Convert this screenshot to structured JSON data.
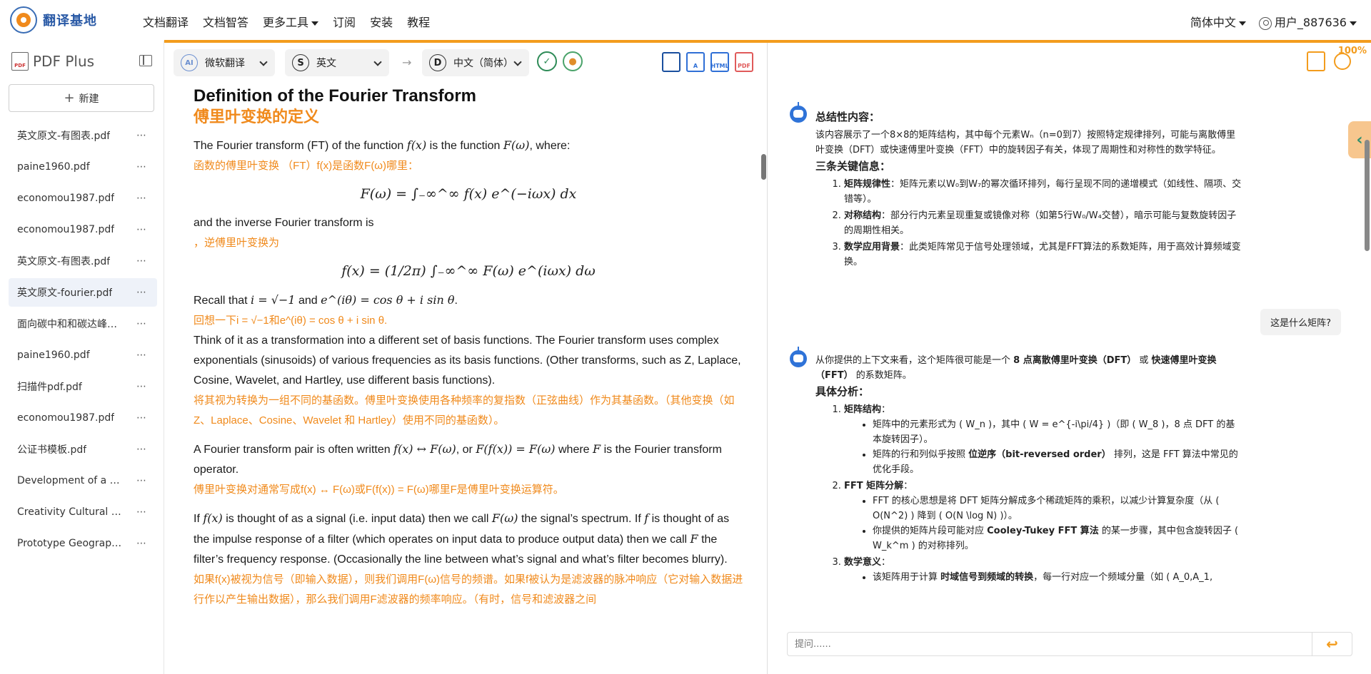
{
  "brand": {
    "name": "翻译基地"
  },
  "nav": {
    "items": [
      "文档翻译",
      "文档智答",
      "更多工具",
      "订阅",
      "安装",
      "教程"
    ],
    "language": "简体中文",
    "user": "用户_887636"
  },
  "sidebar": {
    "title": "PDF Plus",
    "new_label": "新建",
    "files": [
      "英文原文-有图表.pdf",
      "paine1960.pdf",
      "economou1987.pdf",
      "economou1987.pdf",
      "英文原文-有图表.pdf",
      "英文原文-fourier.pdf",
      "面向碳中和和碳达峰…",
      "paine1960.pdf",
      "扫描件pdf.pdf",
      "economou1987.pdf",
      "公证书模板.pdf",
      "Development of a W…",
      "Creativity Cultural Ca…",
      "Prototype Geographi…"
    ],
    "active_index": 5,
    "more": "⋯"
  },
  "toolbar": {
    "engine": "微软翻译",
    "source_lang": "英文",
    "target_lang": "中文（简体）",
    "arrow": "→",
    "src_icon": "S",
    "tgt_icon": "D",
    "engine_icon": "AI",
    "html_label": "HTML",
    "pdf_label": "PDF"
  },
  "document": {
    "title_en": "Definition of the Fourier Transform",
    "title_zh": "傅里叶变换的定义",
    "p1_en_a": "The Fourier transform (FT) of the function ",
    "p1_en_m1": "f(x)",
    "p1_en_b": " is the function ",
    "p1_en_m2": "F(ω)",
    "p1_en_c": ", where:",
    "p1_zh": "函数的傅里叶变换 （FT）f(x)是函数F(ω)哪里：",
    "eq1": "F(ω) = ∫₋∞^∞ f(x) e^(−iωx) dx",
    "p2_en": "and the inverse Fourier transform is",
    "p2_zh": "，逆傅里叶变换为",
    "eq2": "f(x) = (1/2π) ∫₋∞^∞ F(ω) e^(iωx) dω",
    "p3_en_a": "Recall that ",
    "p3_en_m1": "i = √−1",
    "p3_en_b": " and ",
    "p3_en_m2": "e^(iθ) = cos θ + i sin θ",
    "p3_en_c": ".",
    "p3_zh": "回想一下i = √−1和e^(iθ) = cos θ + i sin θ.",
    "p4_en": "Think of it as a transformation into a different set of basis functions. The Fourier transform uses complex exponentials (sinusoids) of various frequencies as its basis functions. (Other transforms, such as Z, Laplace, Cosine, Wavelet, and Hartley, use different basis functions).",
    "p4_zh": "将其视为转换为一组不同的基函数。傅里叶变换使用各种频率的复指数（正弦曲线）作为其基函数。（其他变换（如 Z、Laplace、Cosine、Wavelet 和 Hartley）使用不同的基函数）。",
    "p5_en_a": "A Fourier transform pair is often written ",
    "p5_en_m1": "f(x) ↔ F(ω)",
    "p5_en_b": ", or ",
    "p5_en_m2": "F(f(x)) = F(ω)",
    "p5_en_c": " where ",
    "p5_en_m3": "F",
    "p5_en_d": " is the Fourier transform operator.",
    "p5_zh": "傅里叶变换对通常写成f(x) ↔ F(ω)或F(f(x)) = F(ω)哪里F是傅里叶变换运算符。",
    "p6_en_a": "If ",
    "p6_en_m1": "f(x)",
    "p6_en_b": " is thought of as a signal (i.e. input data) then we call ",
    "p6_en_m2": "F(ω)",
    "p6_en_c": " the signal’s spectrum. If ",
    "p6_en_m3": "f",
    "p6_en_d": " is thought of as the impulse response of a filter (which operates on input data to produce output data) then we call ",
    "p6_en_m4": "F",
    "p6_en_e": " the filter’s frequency response. (Occasionally the line between what’s signal and what’s filter becomes blurry).",
    "p6_zh": "如果f(x)被视为信号（即输入数据），则我们调用F(ω)信号的频谱。如果f被认为是滤波器的脉冲响应（它对输入数据进行作以产生输出数据），那么我们调用F滤波器的频率响应。（有时，信号和滤波器之间"
  },
  "chat": {
    "zoom": "100%",
    "msg1": {
      "h_summary": "总结性内容：",
      "summary": "该内容展示了一个8×8的矩阵结构，其中每个元素Wₙ（n=0到7）按照特定规律排列，可能与离散傅里叶变换（DFT）或快速傅里叶变换（FFT）中的旋转因子有关，体现了周期性和对称性的数学特征。",
      "h_key": "三条关键信息：",
      "k1_b": "矩阵规律性",
      "k1": "：矩阵元素以W₀到W₇的幂次循环排列，每行呈现不同的递增模式（如线性、隔项、交错等）。",
      "k2_b": "对称结构",
      "k2": "：部分行内元素呈现重复或镜像对称（如第5行W₀/W₄交替），暗示可能与复数旋转因子的周期性相关。",
      "k3_b": "数学应用背景",
      "k3": "：此类矩阵常见于信号处理领域，尤其是FFT算法的系数矩阵，用于高效计算频域变换。"
    },
    "user_msg": "这是什么矩阵?",
    "msg2": {
      "intro_a": "从你提供的上下文来看，这个矩阵很可能是一个 ",
      "intro_b1": "8 点离散傅里叶变换（DFT）",
      "intro_c": " 或 ",
      "intro_b2": "快速傅里叶变换（FFT）",
      "intro_d": " 的系数矩阵。",
      "h_analysis": "具体分析：",
      "s1_title": "矩阵结构",
      "s1_c": "：",
      "s1_i1": "矩阵中的元素形式为 ( W_n )，其中 ( W = e^{-i\\pi/4} )（即 ( W_8 )，8 点 DFT 的基本旋转因子）。",
      "s1_i2_a": "矩阵的行和列似乎按照 ",
      "s1_i2_b": "位逆序（bit-reversed order）",
      "s1_i2_c": " 排列，这是 FFT 算法中常见的优化手段。",
      "s2_title": "FFT 矩阵分解",
      "s2_c": "：",
      "s2_i1": "FFT 的核心思想是将 DFT 矩阵分解成多个稀疏矩阵的乘积，以减少计算复杂度（从 ( O(N^2) ) 降到 ( O(N \\log N) )）。",
      "s2_i2_a": "你提供的矩阵片段可能对应 ",
      "s2_i2_b": "Cooley-Tukey FFT 算法",
      "s2_i2_c": " 的某一步骤，其中包含旋转因子 ( W_k^m ) 的对称排列。",
      "s3_title": "数学意义",
      "s3_c": "：",
      "s3_i1_a": "该矩阵用于计算 ",
      "s3_i1_b": "时域信号到频域的转换",
      "s3_i1_c": "，每一行对应一个频域分量（如 ( A_0,A_1,"
    },
    "input_placeholder": "提问......",
    "send_icon": "↩"
  }
}
